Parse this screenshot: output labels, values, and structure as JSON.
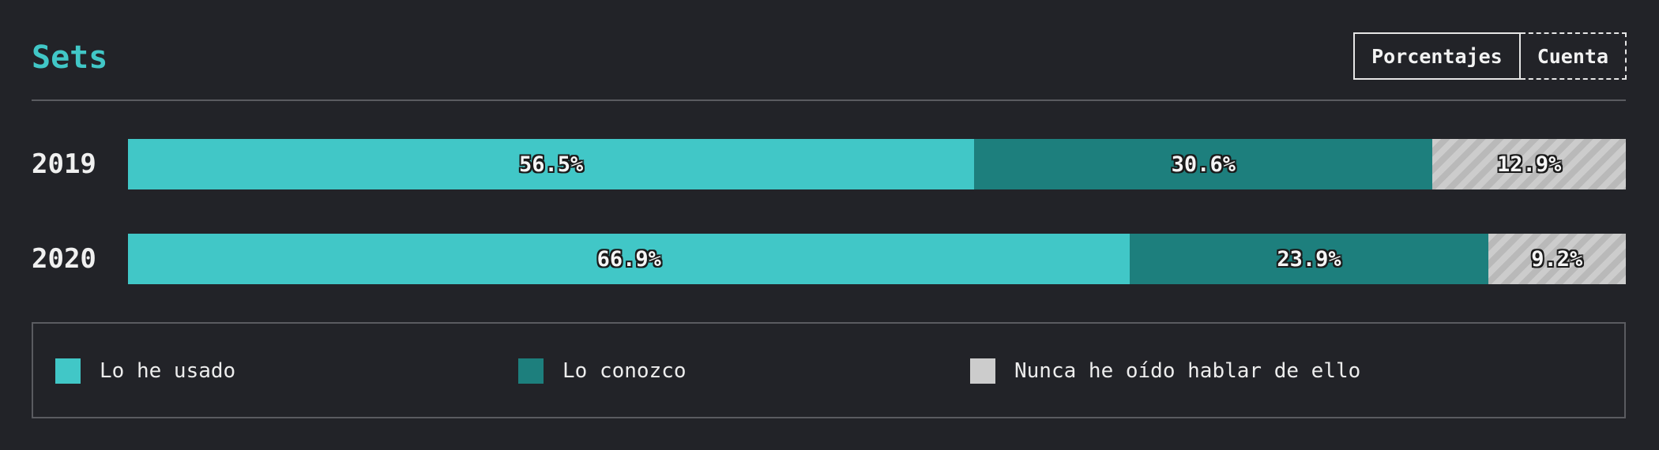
{
  "header": {
    "title": "Sets",
    "toggle": {
      "percent_label": "Porcentajes",
      "count_label": "Cuenta"
    }
  },
  "colors": {
    "used": "#41c7c7",
    "known": "#1d7f7d",
    "never": "#cccccc"
  },
  "chart_data": {
    "type": "bar",
    "stacked": true,
    "orientation": "horizontal",
    "title": "Sets",
    "categories": [
      "2019",
      "2020"
    ],
    "series": [
      {
        "name": "Lo he usado",
        "values": [
          56.5,
          66.9
        ],
        "labels": [
          "56.5%",
          "66.9%"
        ]
      },
      {
        "name": "Lo conozco",
        "values": [
          30.6,
          23.9
        ],
        "labels": [
          "30.6%",
          "23.9%"
        ]
      },
      {
        "name": "Nunca he oído hablar de ello",
        "values": [
          12.9,
          9.2
        ],
        "labels": [
          "12.9%",
          "9.2%"
        ]
      }
    ],
    "xlim": [
      0,
      100
    ],
    "unit": "%",
    "legend_position": "bottom"
  }
}
